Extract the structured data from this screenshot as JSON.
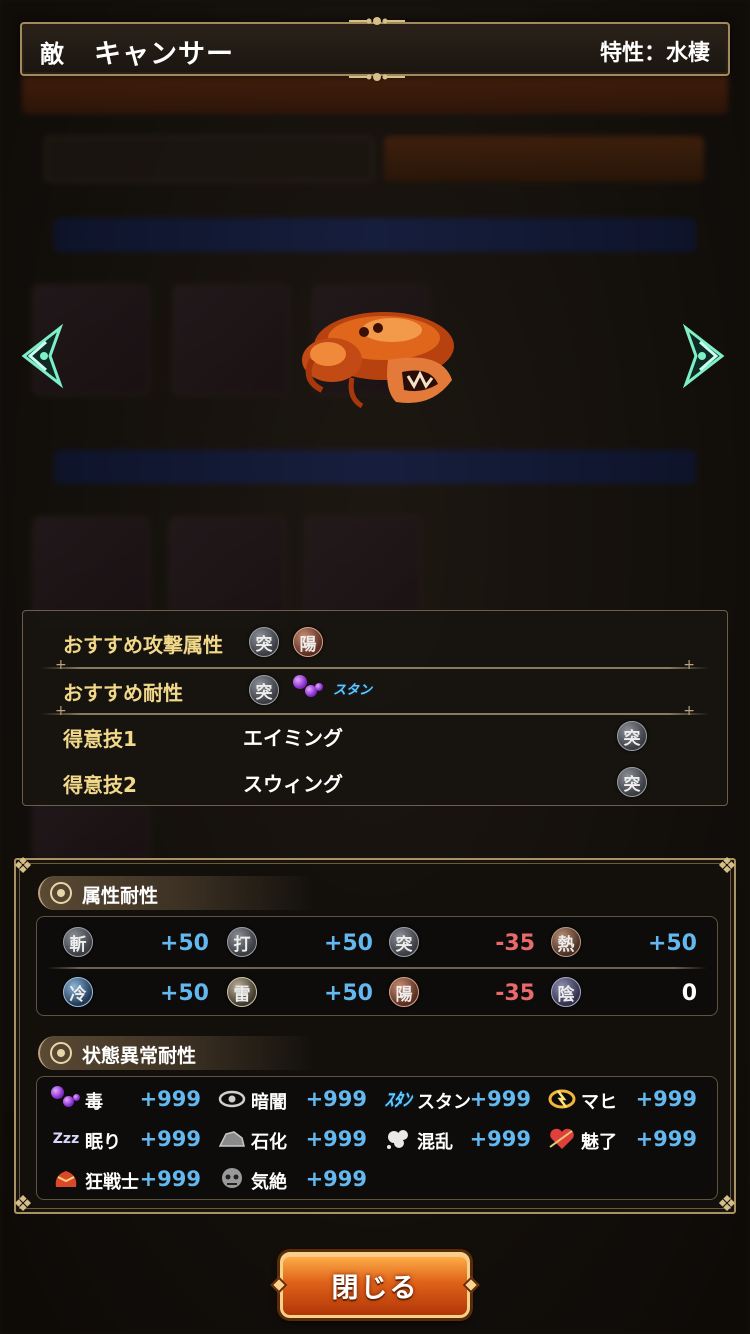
{
  "header": {
    "tag": "敵",
    "enemy_name": "キャンサー",
    "trait": "特性：水棲"
  },
  "info": {
    "recommended_attack_label": "おすすめ攻撃属性",
    "recommended_attack_elements": [
      "突",
      "陽"
    ],
    "recommended_resist_label": "おすすめ耐性",
    "recommended_resist_element": "突",
    "recommended_resist_status": "スタン",
    "skills": [
      {
        "label": "得意技1",
        "name": "エイミング",
        "element": "突"
      },
      {
        "label": "得意技2",
        "name": "スウィング",
        "element": "突"
      }
    ]
  },
  "element_resist": {
    "title": "属性耐性",
    "items": [
      {
        "element": "斬",
        "value": "+50",
        "sign": "pos"
      },
      {
        "element": "打",
        "value": "+50",
        "sign": "pos"
      },
      {
        "element": "突",
        "value": "-35",
        "sign": "neg"
      },
      {
        "element": "熱",
        "value": "+50",
        "sign": "pos"
      },
      {
        "element": "冷",
        "value": "+50",
        "sign": "pos"
      },
      {
        "element": "雷",
        "value": "+50",
        "sign": "pos"
      },
      {
        "element": "陽",
        "value": "-35",
        "sign": "neg"
      },
      {
        "element": "陰",
        "value": "0",
        "sign": "zero"
      }
    ]
  },
  "status_resist": {
    "title": "状態異常耐性",
    "items": [
      {
        "name": "毒",
        "value": "+999",
        "icon": "poison-icon"
      },
      {
        "name": "暗闇",
        "value": "+999",
        "icon": "blind-icon"
      },
      {
        "name": "スタン",
        "value": "+999",
        "icon": "stun-icon"
      },
      {
        "name": "マヒ",
        "value": "+999",
        "icon": "paralysis-icon"
      },
      {
        "name": "眠り",
        "value": "+999",
        "icon": "sleep-icon"
      },
      {
        "name": "石化",
        "value": "+999",
        "icon": "petrify-icon"
      },
      {
        "name": "混乱",
        "value": "+999",
        "icon": "confusion-icon"
      },
      {
        "name": "魅了",
        "value": "+999",
        "icon": "charm-icon"
      },
      {
        "name": "狂戦士",
        "value": "+999",
        "icon": "berserk-icon"
      },
      {
        "name": "気絶",
        "value": "+999",
        "icon": "faint-icon"
      }
    ]
  },
  "stun_glyph": "ｽﾀﾝ",
  "sleep_glyph": "Zzz",
  "close_label": "閉じる"
}
